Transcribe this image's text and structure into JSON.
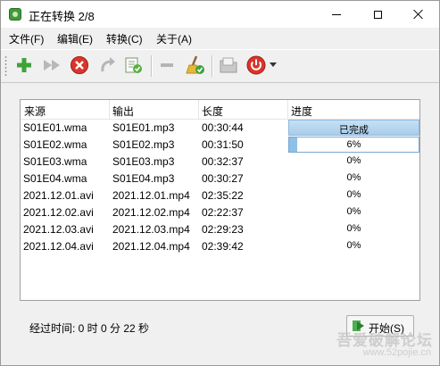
{
  "window": {
    "title": "正在转换 2/8"
  },
  "menu": [
    "文件(F)",
    "编辑(E)",
    "转换(C)",
    "关于(A)"
  ],
  "toolbar": {
    "icons": [
      "add-icon",
      "fast-forward-icon",
      "stop-icon",
      "redo-icon",
      "convert-doc-icon",
      "remove-icon",
      "clean-broom-icon",
      "folder-icon",
      "power-icon",
      "dropdown-arrow-icon"
    ]
  },
  "table": {
    "columns": [
      "来源",
      "输出",
      "长度",
      "进度"
    ],
    "rows": [
      {
        "source": "S01E01.wma",
        "output": "S01E01.mp3",
        "length": "00:30:44",
        "progress_text": "已完成",
        "progress": 1.0
      },
      {
        "source": "S01E02.wma",
        "output": "S01E02.mp3",
        "length": "00:31:50",
        "progress_text": "6%",
        "progress": 0.06
      },
      {
        "source": "S01E03.wma",
        "output": "S01E03.mp3",
        "length": "00:32:37",
        "progress_text": "0%",
        "progress": 0
      },
      {
        "source": "S01E04.wma",
        "output": "S01E04.mp3",
        "length": "00:30:27",
        "progress_text": "0%",
        "progress": 0
      },
      {
        "source": "2021.12.01.avi",
        "output": "2021.12.01.mp4",
        "length": "02:35:22",
        "progress_text": "0%",
        "progress": 0
      },
      {
        "source": "2021.12.02.avi",
        "output": "2021.12.02.mp4",
        "length": "02:22:37",
        "progress_text": "0%",
        "progress": 0
      },
      {
        "source": "2021.12.03.avi",
        "output": "2021.12.03.mp4",
        "length": "02:29:23",
        "progress_text": "0%",
        "progress": 0
      },
      {
        "source": "2021.12.04.avi",
        "output": "2021.12.04.mp4",
        "length": "02:39:42",
        "progress_text": "0%",
        "progress": 0
      }
    ]
  },
  "status": {
    "elapsed": "经过时间: 0 时 0 分 22 秒"
  },
  "start_button": {
    "label": "开始(S)"
  },
  "watermark": {
    "line1": "吾爱破解论坛",
    "line2": "www.52pojie.cn"
  },
  "colors": {
    "progress_done": "#a9cdea",
    "progress_partial": "#8fc0e6",
    "accent_red": "#d9352b",
    "accent_green": "#3fa33a"
  }
}
